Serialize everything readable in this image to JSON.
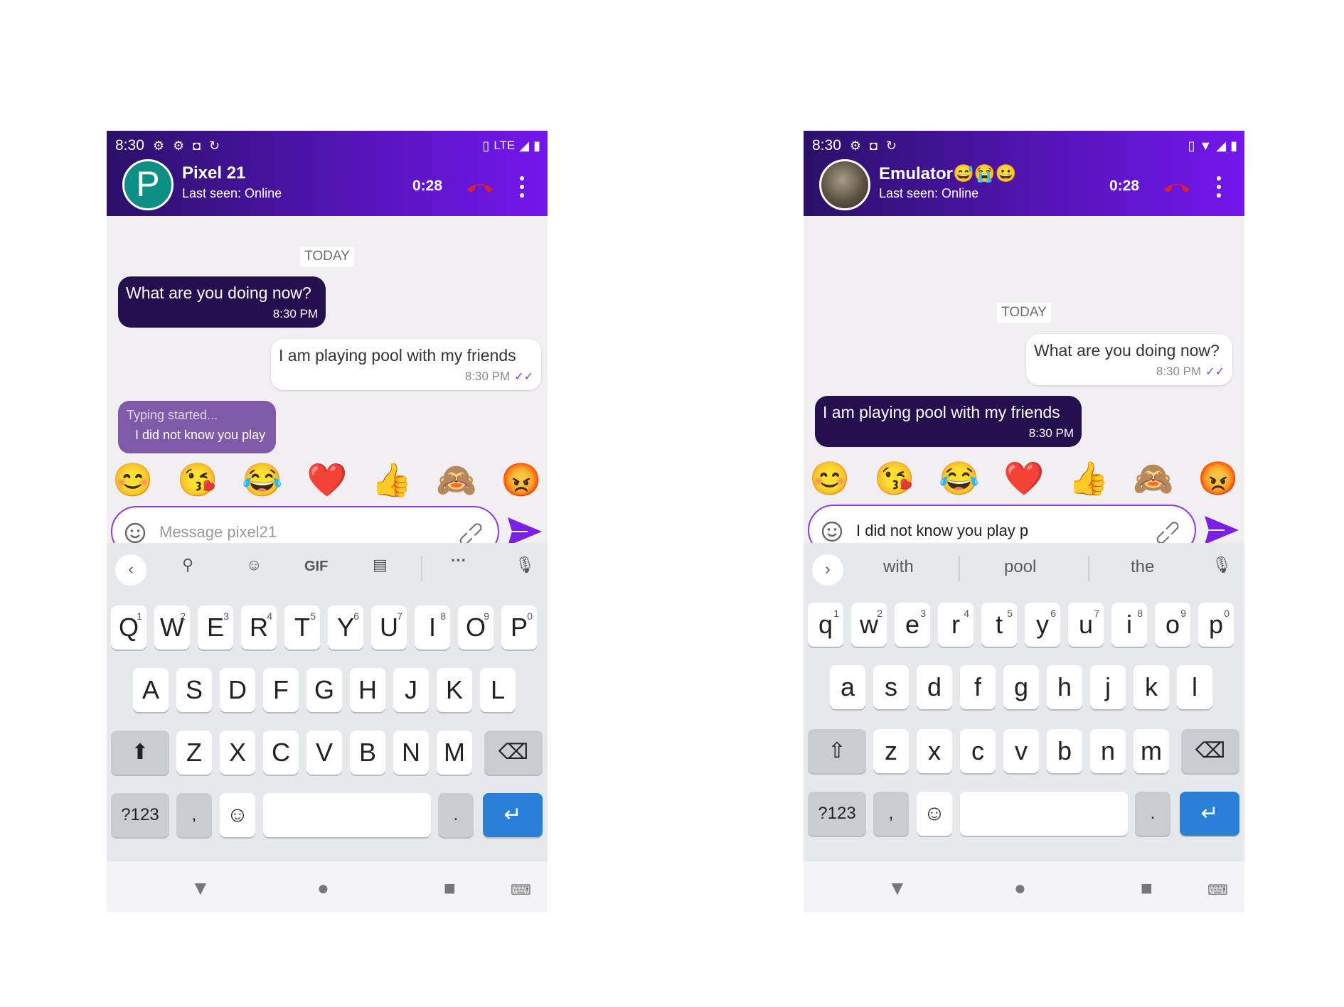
{
  "phones": [
    {
      "status_bar": {
        "time": "8:30",
        "right_text": "LTE"
      },
      "contact": {
        "avatar_letter": "P",
        "name": "Pixel 21",
        "status": "Last seen: Online"
      },
      "call_timer": "0:28",
      "date_chip": "TODAY",
      "messages": [
        {
          "direction": "in",
          "text": "What are you doing now?",
          "time": "8:30 PM"
        },
        {
          "direction": "out",
          "text": "I am playing pool with my friends",
          "time": "8:30 PM",
          "read": true
        }
      ],
      "typing_indicator": {
        "label": "Typing started...",
        "preview": "I did not know you play"
      },
      "emoji_bar": [
        "😊",
        "😘",
        "😂",
        "❤️",
        "👍",
        "🙈",
        "😡"
      ],
      "composer": {
        "placeholder": "Message pixel21",
        "value": ""
      },
      "keyboard": {
        "toolbar": [
          "back-icon",
          "search-icon",
          "sticker-icon",
          "GIF",
          "clipboard-icon",
          "more-icon",
          "mic-icon"
        ],
        "row1": [
          "Q",
          "W",
          "E",
          "R",
          "T",
          "Y",
          "U",
          "I",
          "O",
          "P"
        ],
        "row1_hints": [
          "1",
          "2",
          "3",
          "4",
          "5",
          "6",
          "7",
          "8",
          "9",
          "0"
        ],
        "row2": [
          "A",
          "S",
          "D",
          "F",
          "G",
          "H",
          "J",
          "K",
          "L"
        ],
        "row3": [
          "Z",
          "X",
          "C",
          "V",
          "B",
          "N",
          "M"
        ],
        "symbols_label": "?123",
        "comma": ",",
        "period": "."
      }
    },
    {
      "status_bar": {
        "time": "8:30",
        "right_text": ""
      },
      "contact": {
        "avatar_letter": "",
        "name": "Emulator😅😭😀",
        "status": "Last seen: Online"
      },
      "call_timer": "0:28",
      "date_chip": "TODAY",
      "messages": [
        {
          "direction": "out",
          "text": "What are you doing now?",
          "time": "8:30 PM",
          "read": true
        },
        {
          "direction": "in",
          "text": "I am playing pool with my friends",
          "time": "8:30 PM"
        }
      ],
      "emoji_bar": [
        "😊",
        "😘",
        "😂",
        "❤️",
        "👍",
        "🙈",
        "😡"
      ],
      "composer": {
        "placeholder": "",
        "value": "I did not know you play p"
      },
      "keyboard": {
        "suggestions": [
          "with",
          "pool",
          "the"
        ],
        "row1": [
          "q",
          "w",
          "e",
          "r",
          "t",
          "y",
          "u",
          "i",
          "o",
          "p"
        ],
        "row1_hints": [
          "1",
          "2",
          "3",
          "4",
          "5",
          "6",
          "7",
          "8",
          "9",
          "0"
        ],
        "row2": [
          "a",
          "s",
          "d",
          "f",
          "g",
          "h",
          "j",
          "k",
          "l"
        ],
        "row3": [
          "z",
          "x",
          "c",
          "v",
          "b",
          "n",
          "m"
        ],
        "symbols_label": "?123",
        "comma": ",",
        "period": "."
      }
    }
  ],
  "colors": {
    "header_start": "#2a1068",
    "header_end": "#7416ee",
    "incoming_bubble": "#25104f",
    "accent": "#8b3ddf",
    "enter_key": "#2a7fd6"
  }
}
